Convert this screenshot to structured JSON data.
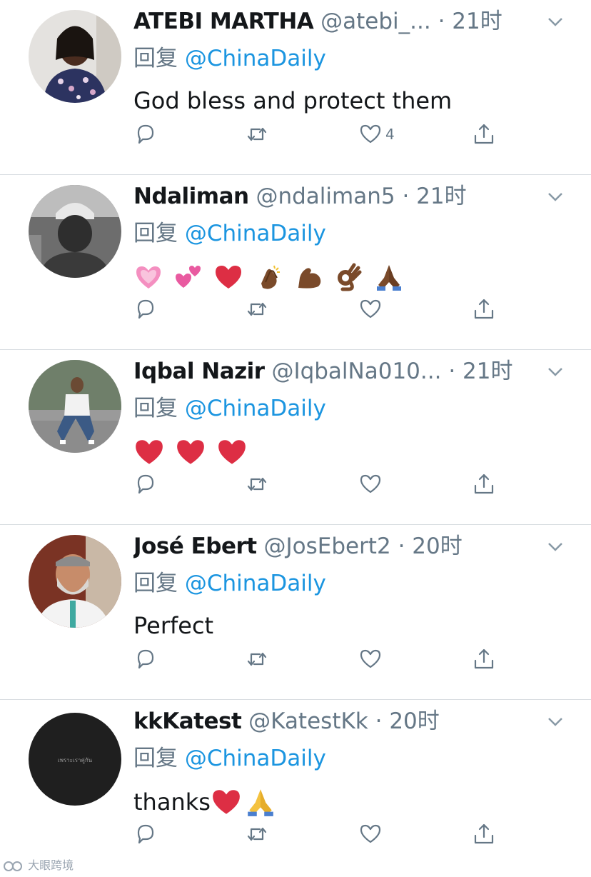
{
  "tweets": [
    {
      "name": "ATEBI MARTHA",
      "handle": "@atebi_...",
      "sep": "·",
      "time": "21时",
      "reply_prefix": "回复",
      "reply_handle": "@ChinaDaily",
      "text": "God bless and protect them",
      "like_count": "4",
      "avatar_icon": "avatar-woman-floral",
      "accent": "#1b95e0"
    },
    {
      "name": "Ndaliman",
      "handle": "@ndaliman5",
      "sep": "·",
      "time": "21时",
      "reply_prefix": "回复",
      "reply_handle": "@ChinaDaily",
      "text": "",
      "emojis": [
        "sparkling-heart",
        "two-hearts",
        "red-heart",
        "clapping-hands",
        "flexed-biceps",
        "ok-hand",
        "folded-hands"
      ],
      "like_count": "",
      "avatar_icon": "avatar-man-cap-grayscale"
    },
    {
      "name": "Iqbal Nazir",
      "handle": "@IqbalNa010...",
      "sep": "·",
      "time": "21时",
      "reply_prefix": "回复",
      "reply_handle": "@ChinaDaily",
      "text": "",
      "emojis": [
        "red-heart",
        "red-heart",
        "red-heart"
      ],
      "like_count": "",
      "avatar_icon": "avatar-man-seated"
    },
    {
      "name": "José Ebert",
      "handle": "@JosEbert2",
      "sep": "·",
      "time": "20时",
      "reply_prefix": "回复",
      "reply_handle": "@ChinaDaily",
      "text": "Perfect",
      "like_count": "",
      "avatar_icon": "avatar-man-beard"
    },
    {
      "name": "kkKatest",
      "handle": "@KatestKk",
      "sep": "·",
      "time": "20时",
      "reply_prefix": "回复",
      "reply_handle": "@ChinaDaily",
      "text": "thanks",
      "text_emojis": [
        "red-heart",
        "folded-hands"
      ],
      "like_count": "",
      "avatar_icon": "avatar-dark-circle",
      "avatar_caption": "เพราะเราคู่กัน"
    }
  ],
  "icons": {
    "reply": "reply-icon",
    "retweet": "retweet-icon",
    "like": "heart-icon",
    "share": "share-icon",
    "more": "chevron-down-icon"
  },
  "colors": {
    "text": "#14171a",
    "muted": "#657786",
    "link": "#1b95e0",
    "divider": "#d8dde1"
  },
  "watermark": "大眼跨境"
}
